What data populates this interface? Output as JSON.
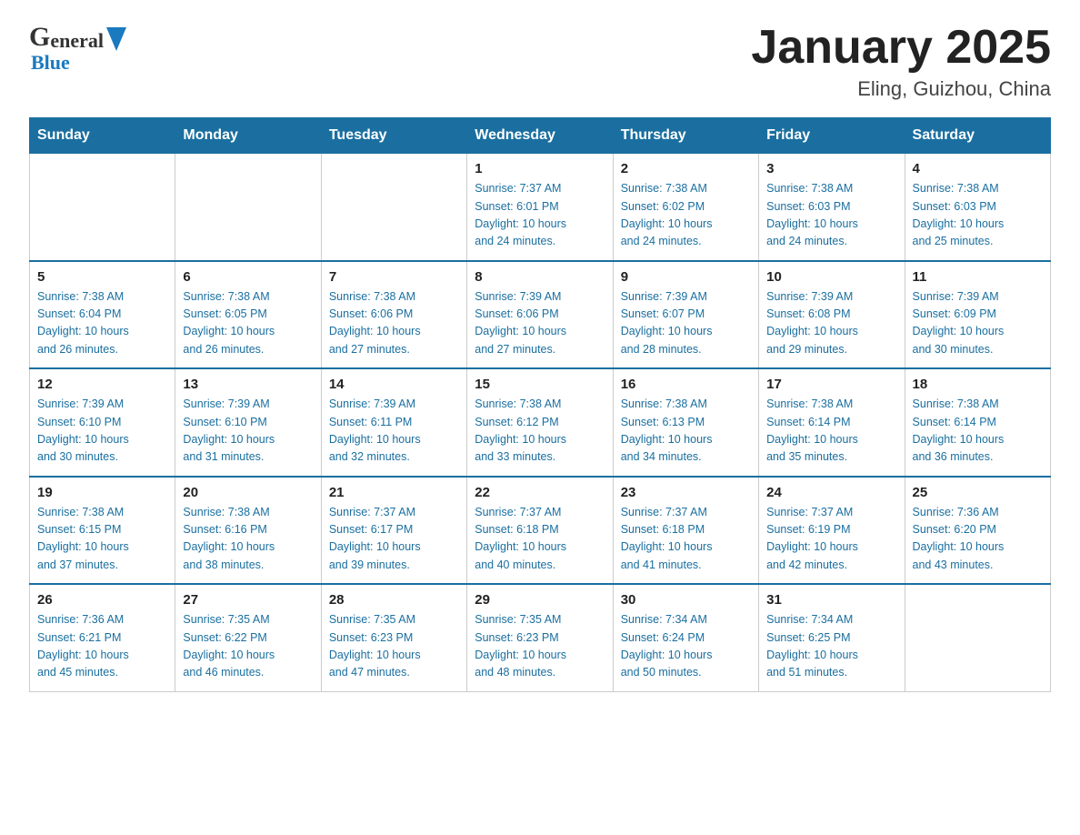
{
  "header": {
    "logo_general": "General",
    "logo_blue": "Blue",
    "month_title": "January 2025",
    "location": "Eling, Guizhou, China"
  },
  "calendar": {
    "days_of_week": [
      "Sunday",
      "Monday",
      "Tuesday",
      "Wednesday",
      "Thursday",
      "Friday",
      "Saturday"
    ],
    "weeks": [
      [
        {
          "day": "",
          "info": ""
        },
        {
          "day": "",
          "info": ""
        },
        {
          "day": "",
          "info": ""
        },
        {
          "day": "1",
          "info": "Sunrise: 7:37 AM\nSunset: 6:01 PM\nDaylight: 10 hours\nand 24 minutes."
        },
        {
          "day": "2",
          "info": "Sunrise: 7:38 AM\nSunset: 6:02 PM\nDaylight: 10 hours\nand 24 minutes."
        },
        {
          "day": "3",
          "info": "Sunrise: 7:38 AM\nSunset: 6:03 PM\nDaylight: 10 hours\nand 24 minutes."
        },
        {
          "day": "4",
          "info": "Sunrise: 7:38 AM\nSunset: 6:03 PM\nDaylight: 10 hours\nand 25 minutes."
        }
      ],
      [
        {
          "day": "5",
          "info": "Sunrise: 7:38 AM\nSunset: 6:04 PM\nDaylight: 10 hours\nand 26 minutes."
        },
        {
          "day": "6",
          "info": "Sunrise: 7:38 AM\nSunset: 6:05 PM\nDaylight: 10 hours\nand 26 minutes."
        },
        {
          "day": "7",
          "info": "Sunrise: 7:38 AM\nSunset: 6:06 PM\nDaylight: 10 hours\nand 27 minutes."
        },
        {
          "day": "8",
          "info": "Sunrise: 7:39 AM\nSunset: 6:06 PM\nDaylight: 10 hours\nand 27 minutes."
        },
        {
          "day": "9",
          "info": "Sunrise: 7:39 AM\nSunset: 6:07 PM\nDaylight: 10 hours\nand 28 minutes."
        },
        {
          "day": "10",
          "info": "Sunrise: 7:39 AM\nSunset: 6:08 PM\nDaylight: 10 hours\nand 29 minutes."
        },
        {
          "day": "11",
          "info": "Sunrise: 7:39 AM\nSunset: 6:09 PM\nDaylight: 10 hours\nand 30 minutes."
        }
      ],
      [
        {
          "day": "12",
          "info": "Sunrise: 7:39 AM\nSunset: 6:10 PM\nDaylight: 10 hours\nand 30 minutes."
        },
        {
          "day": "13",
          "info": "Sunrise: 7:39 AM\nSunset: 6:10 PM\nDaylight: 10 hours\nand 31 minutes."
        },
        {
          "day": "14",
          "info": "Sunrise: 7:39 AM\nSunset: 6:11 PM\nDaylight: 10 hours\nand 32 minutes."
        },
        {
          "day": "15",
          "info": "Sunrise: 7:38 AM\nSunset: 6:12 PM\nDaylight: 10 hours\nand 33 minutes."
        },
        {
          "day": "16",
          "info": "Sunrise: 7:38 AM\nSunset: 6:13 PM\nDaylight: 10 hours\nand 34 minutes."
        },
        {
          "day": "17",
          "info": "Sunrise: 7:38 AM\nSunset: 6:14 PM\nDaylight: 10 hours\nand 35 minutes."
        },
        {
          "day": "18",
          "info": "Sunrise: 7:38 AM\nSunset: 6:14 PM\nDaylight: 10 hours\nand 36 minutes."
        }
      ],
      [
        {
          "day": "19",
          "info": "Sunrise: 7:38 AM\nSunset: 6:15 PM\nDaylight: 10 hours\nand 37 minutes."
        },
        {
          "day": "20",
          "info": "Sunrise: 7:38 AM\nSunset: 6:16 PM\nDaylight: 10 hours\nand 38 minutes."
        },
        {
          "day": "21",
          "info": "Sunrise: 7:37 AM\nSunset: 6:17 PM\nDaylight: 10 hours\nand 39 minutes."
        },
        {
          "day": "22",
          "info": "Sunrise: 7:37 AM\nSunset: 6:18 PM\nDaylight: 10 hours\nand 40 minutes."
        },
        {
          "day": "23",
          "info": "Sunrise: 7:37 AM\nSunset: 6:18 PM\nDaylight: 10 hours\nand 41 minutes."
        },
        {
          "day": "24",
          "info": "Sunrise: 7:37 AM\nSunset: 6:19 PM\nDaylight: 10 hours\nand 42 minutes."
        },
        {
          "day": "25",
          "info": "Sunrise: 7:36 AM\nSunset: 6:20 PM\nDaylight: 10 hours\nand 43 minutes."
        }
      ],
      [
        {
          "day": "26",
          "info": "Sunrise: 7:36 AM\nSunset: 6:21 PM\nDaylight: 10 hours\nand 45 minutes."
        },
        {
          "day": "27",
          "info": "Sunrise: 7:35 AM\nSunset: 6:22 PM\nDaylight: 10 hours\nand 46 minutes."
        },
        {
          "day": "28",
          "info": "Sunrise: 7:35 AM\nSunset: 6:23 PM\nDaylight: 10 hours\nand 47 minutes."
        },
        {
          "day": "29",
          "info": "Sunrise: 7:35 AM\nSunset: 6:23 PM\nDaylight: 10 hours\nand 48 minutes."
        },
        {
          "day": "30",
          "info": "Sunrise: 7:34 AM\nSunset: 6:24 PM\nDaylight: 10 hours\nand 50 minutes."
        },
        {
          "day": "31",
          "info": "Sunrise: 7:34 AM\nSunset: 6:25 PM\nDaylight: 10 hours\nand 51 minutes."
        },
        {
          "day": "",
          "info": ""
        }
      ]
    ]
  }
}
